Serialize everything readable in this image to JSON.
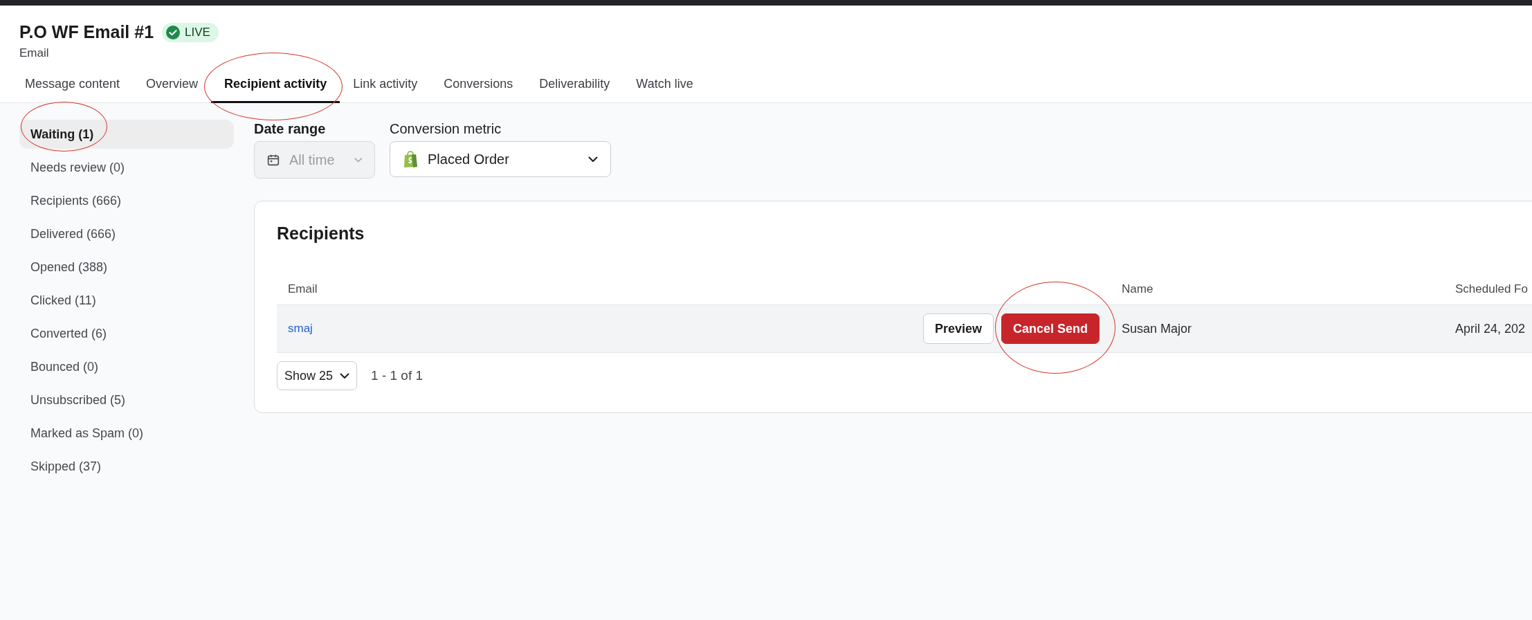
{
  "header": {
    "title": "P.O WF Email #1",
    "status": "LIVE",
    "subtitle": "Email"
  },
  "tabs": [
    {
      "label": "Message content",
      "selected": false,
      "circled": false
    },
    {
      "label": "Overview",
      "selected": false,
      "circled": false
    },
    {
      "label": "Recipient activity",
      "selected": true,
      "circled": true
    },
    {
      "label": "Link activity",
      "selected": false,
      "circled": false
    },
    {
      "label": "Conversions",
      "selected": false,
      "circled": false
    },
    {
      "label": "Deliverability",
      "selected": false,
      "circled": false
    },
    {
      "label": "Watch live",
      "selected": false,
      "circled": false
    }
  ],
  "sidebar": {
    "items": [
      {
        "label": "Waiting (1)",
        "selected": true,
        "circled": true
      },
      {
        "label": "Needs review (0)",
        "selected": false,
        "circled": false
      },
      {
        "label": "Recipients (666)",
        "selected": false,
        "circled": false
      },
      {
        "label": "Delivered (666)",
        "selected": false,
        "circled": false
      },
      {
        "label": "Opened (388)",
        "selected": false,
        "circled": false
      },
      {
        "label": "Clicked (11)",
        "selected": false,
        "circled": false
      },
      {
        "label": "Converted (6)",
        "selected": false,
        "circled": false
      },
      {
        "label": "Bounced (0)",
        "selected": false,
        "circled": false
      },
      {
        "label": "Unsubscribed (5)",
        "selected": false,
        "circled": false
      },
      {
        "label": "Marked as Spam (0)",
        "selected": false,
        "circled": false
      },
      {
        "label": "Skipped (37)",
        "selected": false,
        "circled": false
      }
    ]
  },
  "filters": [
    {
      "kind": "date",
      "label": "Date range",
      "strong": true,
      "value": "All time",
      "disabled": true
    },
    {
      "kind": "metric",
      "label": "Conversion metric",
      "strong": false,
      "value": "Placed Order",
      "disabled": false
    }
  ],
  "recipients": {
    "title": "Recipients",
    "columns": [
      "Email",
      "Name",
      "Scheduled Fo"
    ],
    "rows": [
      {
        "email": "smaj",
        "actions": [
          {
            "kind": "secondary",
            "label": "Preview",
            "circled": false
          },
          {
            "kind": "danger",
            "label": "Cancel Send",
            "circled": true
          }
        ],
        "name": "Susan Major",
        "scheduled": "April 24, 202"
      }
    ],
    "page_size": "Show 25",
    "range": "1 - 1 of 1"
  }
}
